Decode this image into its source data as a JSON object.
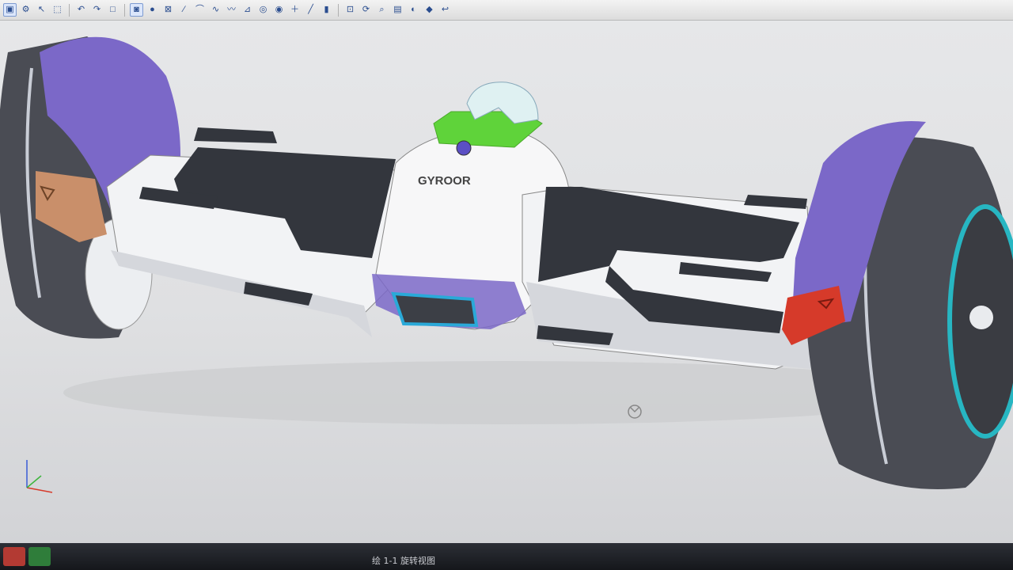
{
  "toolbar": {
    "icons": [
      "select-icon",
      "filter-icon",
      "pointer-icon",
      "box-select-icon",
      "undo-icon",
      "redo-icon",
      "rectangle-icon",
      "shaded-icon",
      "sphere-icon",
      "wireframe-icon",
      "line-icon",
      "arc-icon",
      "curve-icon",
      "spline-icon",
      "edge-icon",
      "circle-icon",
      "point-icon",
      "cross-icon",
      "measure-icon",
      "layer-icon",
      "view-icon",
      "rotate-icon",
      "zoom-icon",
      "display-icon",
      "material-icon",
      "render-icon",
      "history-icon"
    ]
  },
  "viewport": {
    "logo_text": "GYROOR",
    "colors": {
      "fender": "#7b68c8",
      "body": "#f2f3f5",
      "pad": "#33363d",
      "tire": "#4a4c54",
      "handle_base": "#5fd33a",
      "reflector_left": "#c98f6a",
      "reflector_right": "#d63a2a",
      "rim_accent": "#27b6c2",
      "light_ring": "#2aa9d8"
    }
  },
  "statusbar": {
    "view_label": "绘 1-1 旋转视图"
  }
}
